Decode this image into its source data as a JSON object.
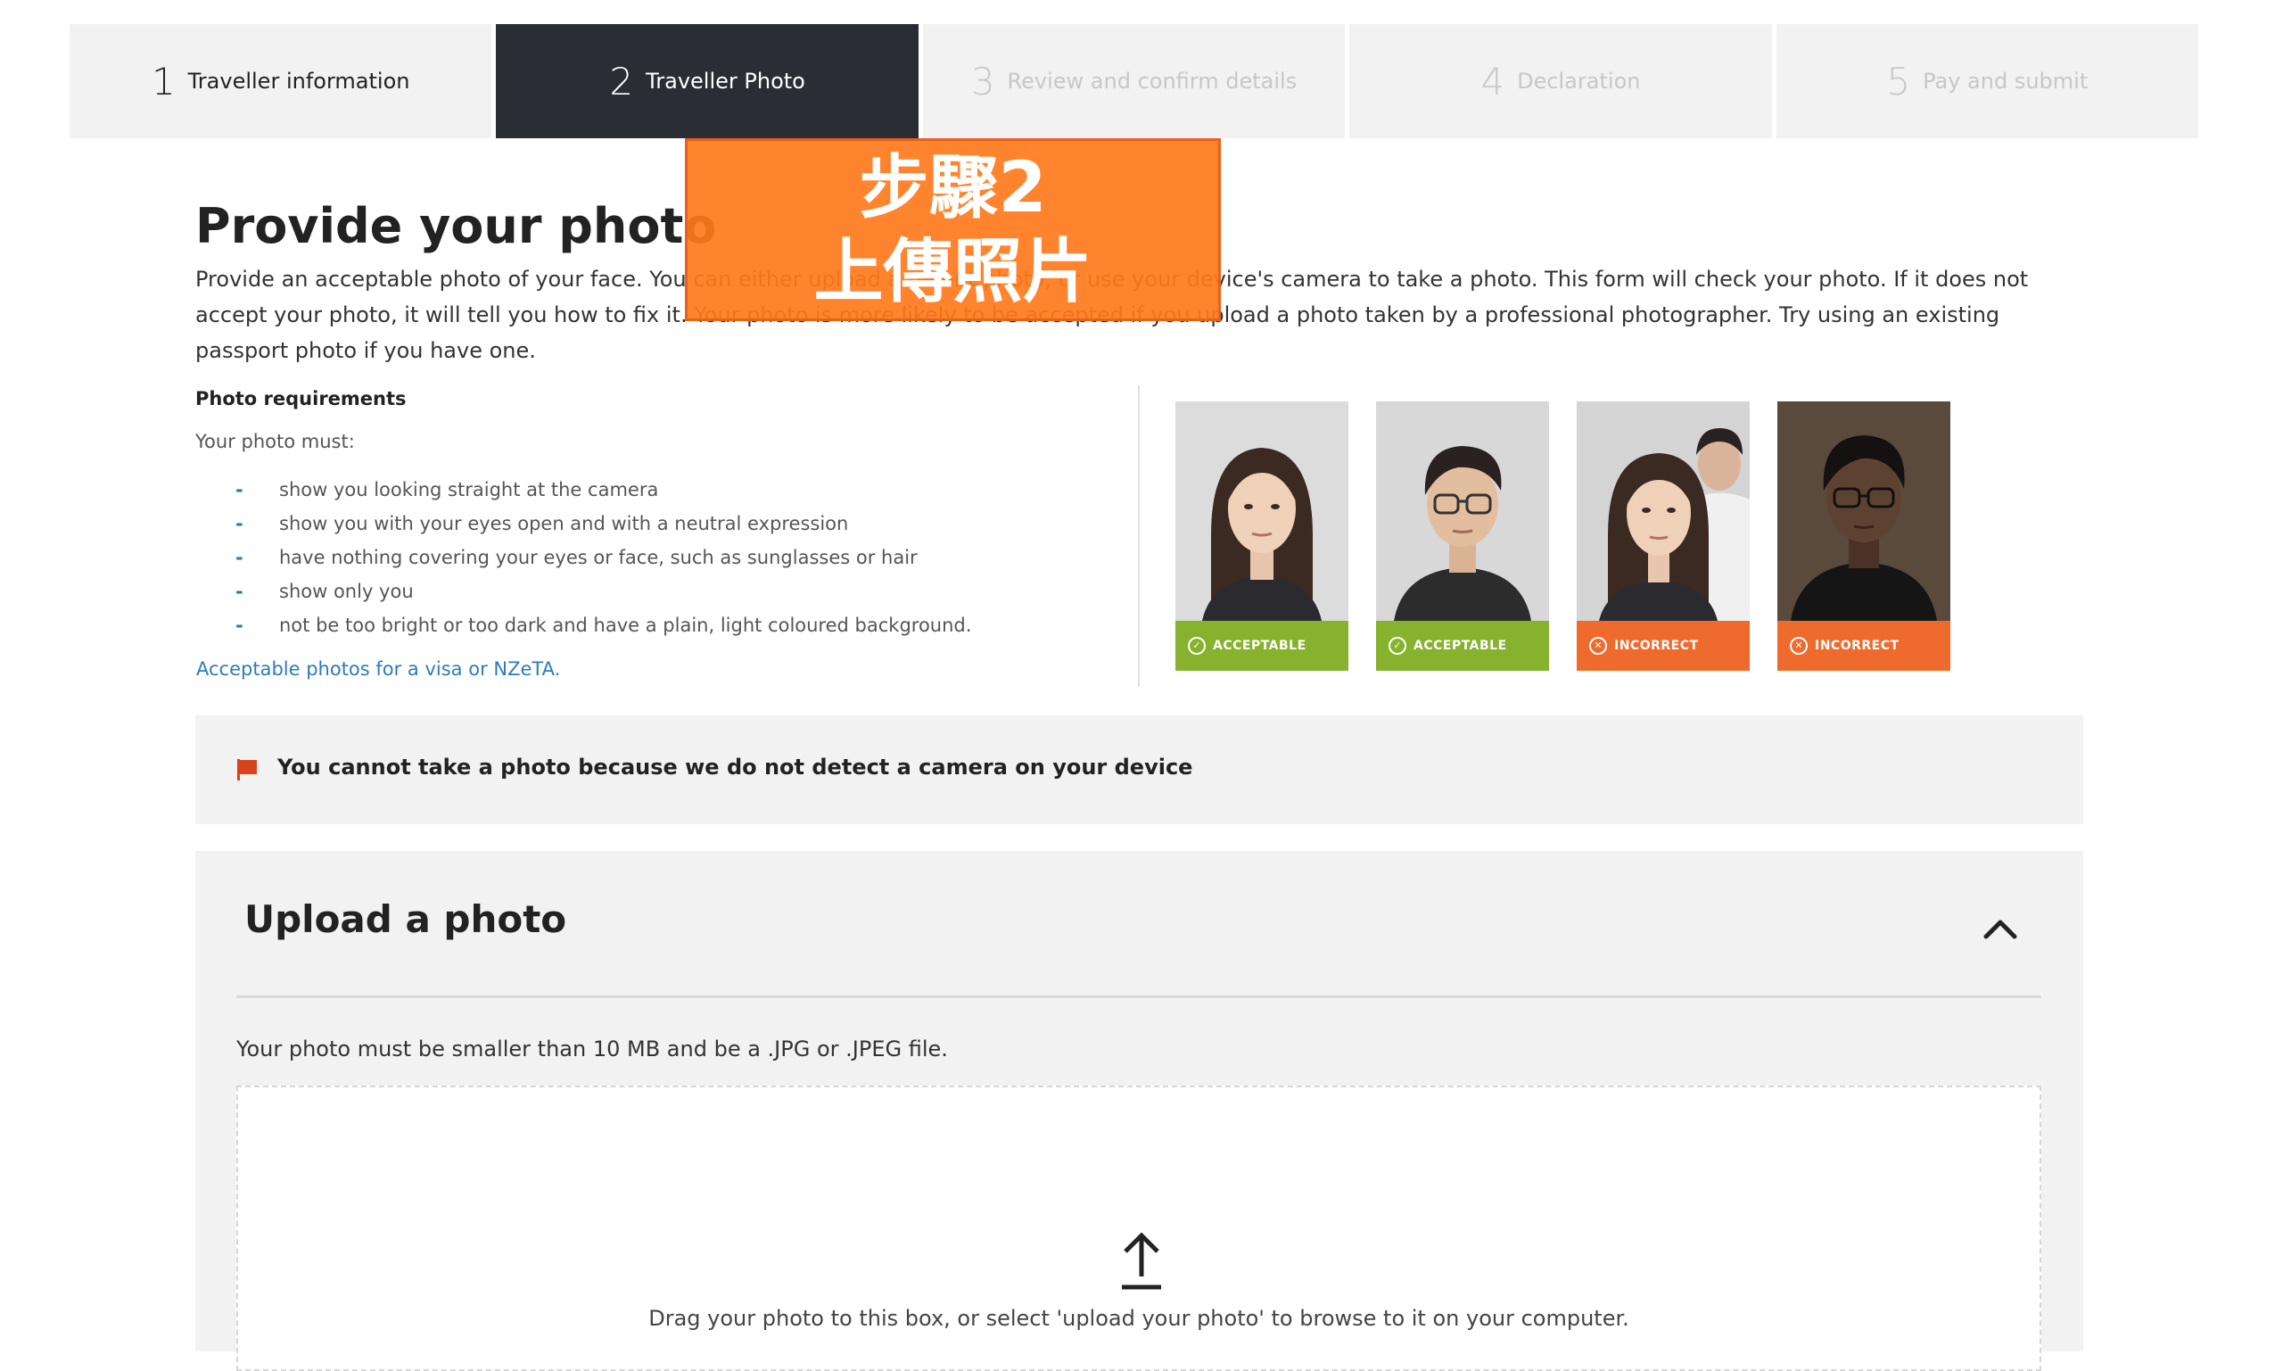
{
  "stepper": [
    {
      "num": "1",
      "label": "Traveller information",
      "state": "done"
    },
    {
      "num": "2",
      "label": "Traveller Photo",
      "state": "active"
    },
    {
      "num": "3",
      "label": "Review and confirm details",
      "state": "future"
    },
    {
      "num": "4",
      "label": "Declaration",
      "state": "future"
    },
    {
      "num": "5",
      "label": "Pay and submit",
      "state": "future"
    }
  ],
  "overlay": {
    "line1": "步驟2",
    "line2": "上傳照片"
  },
  "page": {
    "title": "Provide your photo",
    "intro": "Provide an acceptable photo of your face. You can either upload a recent photo, or use your device's camera to take a photo. This form will check your photo. If it does not accept your photo, it will tell you how to fix it. Your photo is more likely to be accepted if you upload a photo taken by a professional photographer. Try using an existing passport photo if you have one."
  },
  "requirements": {
    "title": "Photo requirements",
    "intro": "Your photo must:",
    "items": [
      "show you looking straight at the camera",
      "show you with your eyes open and with a neutral expression",
      "have nothing covering your eyes or face, such as sunglasses or hair",
      "show only you",
      "not be too bright or too dark and have a plain, light coloured background."
    ],
    "link": "Acceptable photos for a visa or NZeTA."
  },
  "examples": [
    {
      "label": "ACCEPTABLE",
      "status": "ok"
    },
    {
      "label": "ACCEPTABLE",
      "status": "ok"
    },
    {
      "label": "INCORRECT",
      "status": "bad"
    },
    {
      "label": "INCORRECT",
      "status": "bad"
    }
  ],
  "camera_notice": "You cannot take a photo because we do not detect a camera on your device",
  "upload": {
    "title": "Upload a photo",
    "note": "Your photo must be smaller than 10 MB and be a .JPG or .JPEG file.",
    "drop_text": "Drag your photo to this box, or select 'upload your photo' to browse to it on your computer."
  },
  "colors": {
    "accent_link": "#2d7bbd",
    "active_step": "#2b2d35",
    "acceptable": "#86b22d",
    "incorrect": "#ee6a2d",
    "notice_flag": "#d9421e",
    "overlay": "#ff7a1b"
  }
}
